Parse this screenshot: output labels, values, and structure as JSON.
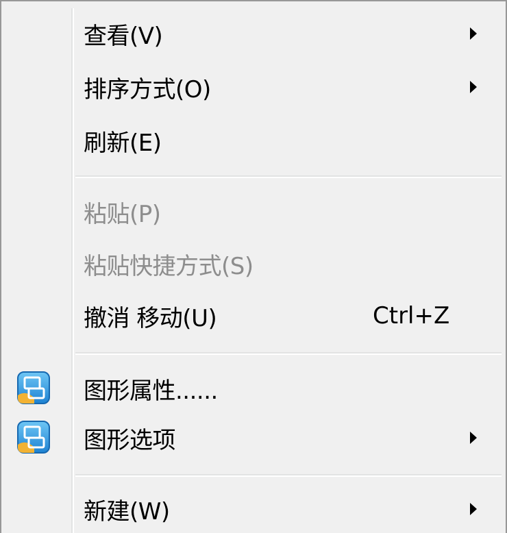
{
  "context_menu": {
    "items": [
      {
        "label": "查看(V)",
        "submenu": true,
        "disabled": false
      },
      {
        "label": "排序方式(O)",
        "submenu": true,
        "disabled": false
      },
      {
        "label": "刷新(E)",
        "submenu": false,
        "disabled": false
      },
      {
        "label": "粘贴(P)",
        "submenu": false,
        "disabled": true
      },
      {
        "label": "粘贴快捷方式(S)",
        "submenu": false,
        "disabled": true
      },
      {
        "label": "撤消 移动(U)",
        "shortcut": "Ctrl+Z",
        "submenu": false,
        "disabled": false
      },
      {
        "label": "图形属性......",
        "icon": "graphics-icon",
        "submenu": false,
        "disabled": false
      },
      {
        "label": "图形选项",
        "icon": "graphics-icon",
        "submenu": true,
        "disabled": false
      },
      {
        "label": "新建(W)",
        "submenu": true,
        "disabled": false
      }
    ]
  },
  "colors": {
    "background": "#f0f0f0",
    "border": "#979797",
    "disabled_text": "#8d8d8d",
    "text": "#000000"
  }
}
